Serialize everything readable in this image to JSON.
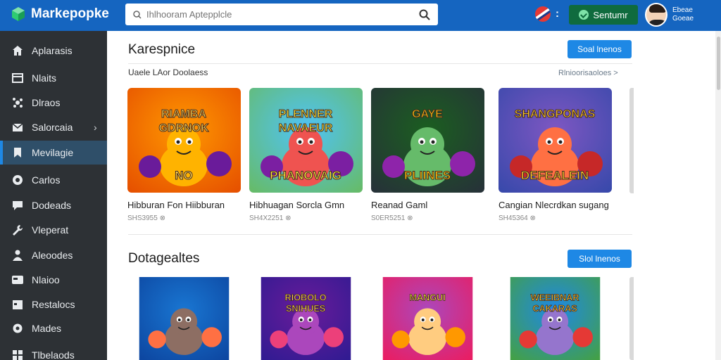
{
  "app": {
    "name": "Markepopke"
  },
  "search": {
    "placeholder": "Ihlhooram Aptepplcle"
  },
  "header": {
    "signin_label": "Sentumr",
    "user_line1": "Ebeae",
    "user_line2": "Goeae"
  },
  "sidebar": {
    "items": [
      {
        "label": "Aplarasis",
        "icon": "home-icon"
      },
      {
        "label": "Nlaits",
        "icon": "window-icon"
      },
      {
        "label": "Dlraos",
        "icon": "gear-icon"
      },
      {
        "label": "Salorcaia",
        "icon": "mail-icon",
        "has_chevron": true
      },
      {
        "label": "Mevilagie",
        "icon": "bookmark-icon",
        "active": true
      },
      {
        "label": "Carlos",
        "icon": "compass-icon"
      },
      {
        "label": "Dodeads",
        "icon": "chat-icon"
      },
      {
        "label": "Vleperat",
        "icon": "wrench-icon"
      },
      {
        "label": "Aleoodes",
        "icon": "person-icon"
      },
      {
        "label": "Nlaioo",
        "icon": "card-icon"
      },
      {
        "label": "Restalocs",
        "icon": "calendar-icon"
      },
      {
        "label": "Mades",
        "icon": "settings-icon"
      },
      {
        "label": "Tlbelaods",
        "icon": "grid-icon"
      }
    ]
  },
  "sections": [
    {
      "title": "Karespnice",
      "see_all_label": "Soal lnenos",
      "subtitle": "Uaele LAor Doolaess",
      "more_label": "Rlnioorisaoloes >",
      "cards": [
        {
          "title": "Hibburan Fon Hiibburan",
          "meta": "SHS3955 ⊗",
          "art_text": "RIAMBA GDRNOK",
          "art_sub": "NO"
        },
        {
          "title": "Hibhuagan Sorcla Gmn",
          "meta": "SH4X2251 ⊗",
          "art_text": "PLENNER NAVAEUR",
          "art_sub": "PHANOVAIG"
        },
        {
          "title": "Reanad Gaml",
          "meta": "S0ER5251 ⊗",
          "art_text": "GAYE",
          "art_sub": "PLIINES"
        },
        {
          "title": "Cangian Nlecrdkan sugang",
          "meta": "SH45364 ⊗",
          "art_text": "SHANGPONAS",
          "art_sub": "DEFEALEIN"
        }
      ]
    },
    {
      "title": "Dotagealtes",
      "see_all_label": "Slol lnenos",
      "cards": [
        {
          "art_text": ""
        },
        {
          "art_text": "RIOBOLO SNIHUES"
        },
        {
          "art_text": "MANGUI"
        },
        {
          "art_text": "WEEIBNAR CAKARAS"
        }
      ]
    }
  ],
  "colors": {
    "topbar": "#1565c0",
    "sidebar": "#2d3135",
    "accent": "#1e88e5",
    "signin": "#0f6b3e"
  }
}
